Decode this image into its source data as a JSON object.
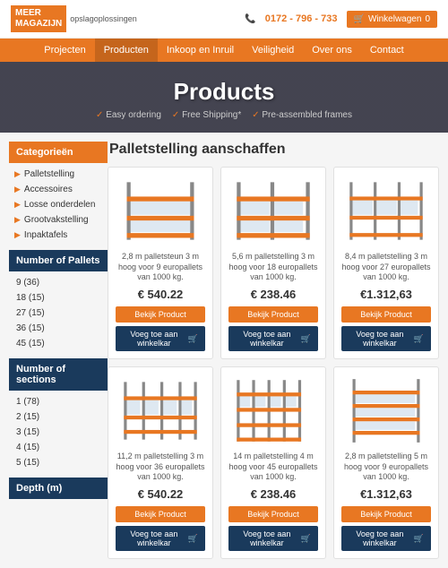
{
  "header": {
    "logo_line1": "MEER",
    "logo_line2": "MAGAZIJN",
    "logo_sub": "opslagoplossingen",
    "phone": "0172 - 796 - 733",
    "cart_label": "Winkelwagen",
    "cart_count": "0"
  },
  "nav": {
    "items": [
      {
        "label": "Projecten",
        "active": false
      },
      {
        "label": "Producten",
        "active": true
      },
      {
        "label": "Inkoop en Inruil",
        "active": false
      },
      {
        "label": "Veiligheid",
        "active": false
      },
      {
        "label": "Over ons",
        "active": false
      },
      {
        "label": "Contact",
        "active": false
      }
    ]
  },
  "hero": {
    "title": "Products",
    "sub1": "Easy ordering",
    "sub2": "Free Shipping*",
    "sub3": "Pre-assembled frames"
  },
  "sidebar": {
    "categories_title": "Categorieën",
    "categories": [
      {
        "label": "Palletstelling"
      },
      {
        "label": "Accessoires"
      },
      {
        "label": "Losse onderdelen"
      },
      {
        "label": "Grootvakstelling"
      },
      {
        "label": "Inpaktafels"
      }
    ],
    "pallets_title": "Number of Pallets",
    "pallets": [
      {
        "label": "9 (36)"
      },
      {
        "label": "18 (15)"
      },
      {
        "label": "27 (15)"
      },
      {
        "label": "36 (15)"
      },
      {
        "label": "45 (15)"
      }
    ],
    "sections_title": "Number of sections",
    "sections": [
      {
        "label": "1 (78)"
      },
      {
        "label": "2 (15)"
      },
      {
        "label": "3 (15)"
      },
      {
        "label": "4 (15)"
      },
      {
        "label": "5 (15)"
      }
    ],
    "depth_title": "Depth (m)"
  },
  "products": {
    "page_title": "Palletstelling aanschaffen",
    "items": [
      {
        "desc": "2,8 m palletsteun 3 m hoog voor 9 europallets van 1000 kg.",
        "price": "€ 540.22",
        "view_label": "Bekijk Product",
        "cart_label": "Voeg toe aan winkelkar"
      },
      {
        "desc": "5,6 m palletstelling 3 m hoog voor 18 europallets van 1000 kg.",
        "price": "€ 238.46",
        "view_label": "Bekijk Product",
        "cart_label": "Voeg toe aan winkelkar"
      },
      {
        "desc": "8,4 m palletstelling 3 m hoog voor 27 europallets van 1000 kg.",
        "price": "€1.312,63",
        "view_label": "Bekijk Product",
        "cart_label": "Voeg toe aan winkelkar"
      },
      {
        "desc": "11,2 m palletstelling 3 m hoog voor 36 europallets van 1000 kg.",
        "price": "€ 540.22",
        "view_label": "Bekijk Product",
        "cart_label": "Voeg toe aan winkelkar"
      },
      {
        "desc": "14 m palletstelling 4 m hoog voor 45 europallets van 1000 kg.",
        "price": "€ 238.46",
        "view_label": "Bekijk Product",
        "cart_label": "Voeg toe aan winkelkar"
      },
      {
        "desc": "2,8 m palletstelling 5 m hoog voor 9 europallets van 1000 kg.",
        "price": "€1.312,63",
        "view_label": "Bekijk Product",
        "cart_label": "Voeg toe aan winkelkar"
      }
    ]
  }
}
